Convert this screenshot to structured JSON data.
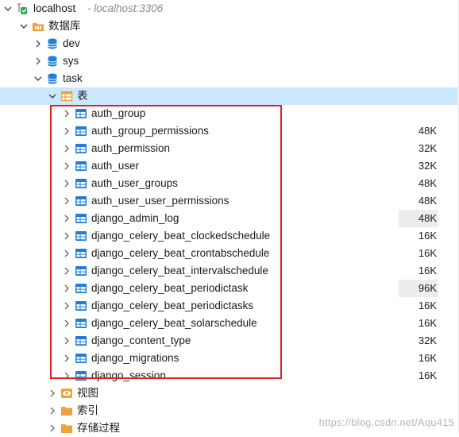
{
  "connection": {
    "name": "localhost",
    "subtitle": "- localhost:3306"
  },
  "databases_folder": {
    "label": "数据库"
  },
  "databases": [
    {
      "name": "dev"
    },
    {
      "name": "sys"
    },
    {
      "name": "task"
    }
  ],
  "tables_folder": {
    "label": "表"
  },
  "tables": [
    {
      "name": "auth_group",
      "size": ""
    },
    {
      "name": "auth_group_permissions",
      "size": "48K"
    },
    {
      "name": "auth_permission",
      "size": "32K"
    },
    {
      "name": "auth_user",
      "size": "32K"
    },
    {
      "name": "auth_user_groups",
      "size": "48K"
    },
    {
      "name": "auth_user_user_permissions",
      "size": "48K"
    },
    {
      "name": "django_admin_log",
      "size": "48K"
    },
    {
      "name": "django_celery_beat_clockedschedule",
      "size": "16K"
    },
    {
      "name": "django_celery_beat_crontabschedule",
      "size": "16K"
    },
    {
      "name": "django_celery_beat_intervalschedule",
      "size": "16K"
    },
    {
      "name": "django_celery_beat_periodictask",
      "size": "96K"
    },
    {
      "name": "django_celery_beat_periodictasks",
      "size": "16K"
    },
    {
      "name": "django_celery_beat_solarschedule",
      "size": "16K"
    },
    {
      "name": "django_content_type",
      "size": "32K"
    },
    {
      "name": "django_migrations",
      "size": "16K"
    },
    {
      "name": "django_session",
      "size": "16K"
    }
  ],
  "other_folders": [
    {
      "label": "视图",
      "icon": "view-icon"
    },
    {
      "label": "索引",
      "icon": "folder-icon"
    },
    {
      "label": "存储过程",
      "icon": "folder-icon"
    }
  ],
  "watermark": "https://blog.csdn.net/Aqu415",
  "colors": {
    "selection": "#cce8ff",
    "highlight_border": "#e02020",
    "table_icon": "#1e7fd6",
    "db_icon": "#1e7fd6",
    "folder_icon": "#f0a23a"
  }
}
